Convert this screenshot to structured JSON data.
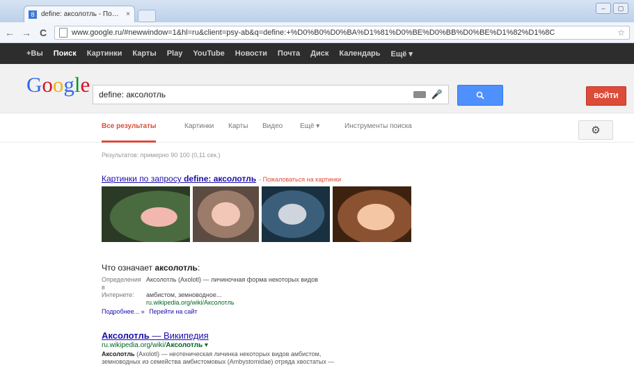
{
  "browser": {
    "tab_title": "define: аксолотль - Поиск в",
    "tab_close": "×",
    "back": "←",
    "forward": "→",
    "reload": "C",
    "url": "www.google.ru/#newwindow=1&hl=ru&client=psy-ab&q=define:+%D0%B0%D0%BA%D1%81%D0%BE%D0%BB%D0%BE%D1%82%D1%8C",
    "win_min": "–",
    "win_max": "▢"
  },
  "gbar": {
    "items": [
      "+Вы",
      "Поиск",
      "Картинки",
      "Карты",
      "Play",
      "YouTube",
      "Новости",
      "Почта",
      "Диск",
      "Календарь",
      "Ещё ▾"
    ]
  },
  "header": {
    "logo": [
      "G",
      "o",
      "o",
      "g",
      "l",
      "e"
    ],
    "logo_colors": [
      "#3369e8",
      "#d50f25",
      "#eeb211",
      "#3369e8",
      "#009925",
      "#d50f25"
    ],
    "query": "define: аксолотль",
    "signin": "ВОЙТИ"
  },
  "tabs": [
    "Все результаты",
    "Картинки",
    "Карты",
    "Видео",
    "Ещё ▾",
    "Инструменты поиска"
  ],
  "results": {
    "stats": "Результатов: примерно 90 100 (0,11 сек.)",
    "images_prefix": "Картинки по запросу ",
    "images_query": "define: аксолотль",
    "images_note": "- Пожаловаться на картинки",
    "def_prefix": "Что означает ",
    "def_word": "аксолотль",
    "def_suffix": ":",
    "def_label_1": "Определения в",
    "def_label_2": "Интернете:",
    "def_text_1": "Аксолотль (Axolotl) — личиночная форма некоторых видов",
    "def_text_2": "амбистом, земноводное...",
    "def_url": "ru.wikipedia.org/wiki/Аксолотль",
    "more": "Подробнее... »",
    "goto": "Перейти на сайт",
    "res_title_bold": "Аксолотль",
    "res_title_rest": " — Википедия",
    "res_url_plain": "ru.wikipedia.org/wiki/",
    "res_url_bold": "Аксолотль",
    "res_url_arrow": " ▾",
    "snippet_bold": "Аксолотль",
    "snippet_1": " (Axolotl) — неотеническая личинка некоторых видов амбистом,",
    "snippet_2": "земноводных из семейства амбистомовых (Ambystomidae) отряда хвостатых —"
  }
}
